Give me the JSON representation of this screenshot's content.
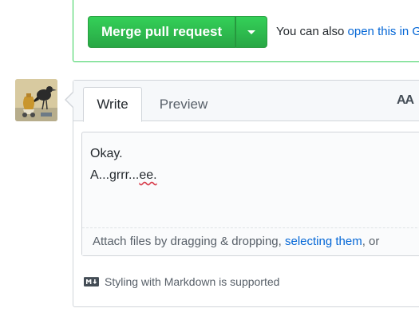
{
  "merge": {
    "button_label": "Merge pull request",
    "also_text": "You can also ",
    "also_link": "open this in G"
  },
  "comment": {
    "tabs": [
      {
        "label": "Write"
      },
      {
        "label": "Preview"
      }
    ],
    "text_size_icon": "AA",
    "editor_lines": [
      "Okay.",
      "A...grrr...",
      "ee."
    ],
    "drop_prefix": "Attach files by dragging & dropping, ",
    "drop_link": "selecting them",
    "drop_suffix": ", or ",
    "markdown_note": "Styling with Markdown is supported"
  },
  "colors": {
    "merge_green": "#2cbe4e",
    "link_blue": "#0366d6",
    "border_gray": "#d1d5da"
  },
  "icons": {
    "dropdown": "chevron-down-icon",
    "markdown": "markdown-icon",
    "text_size": "text-size-icon"
  }
}
